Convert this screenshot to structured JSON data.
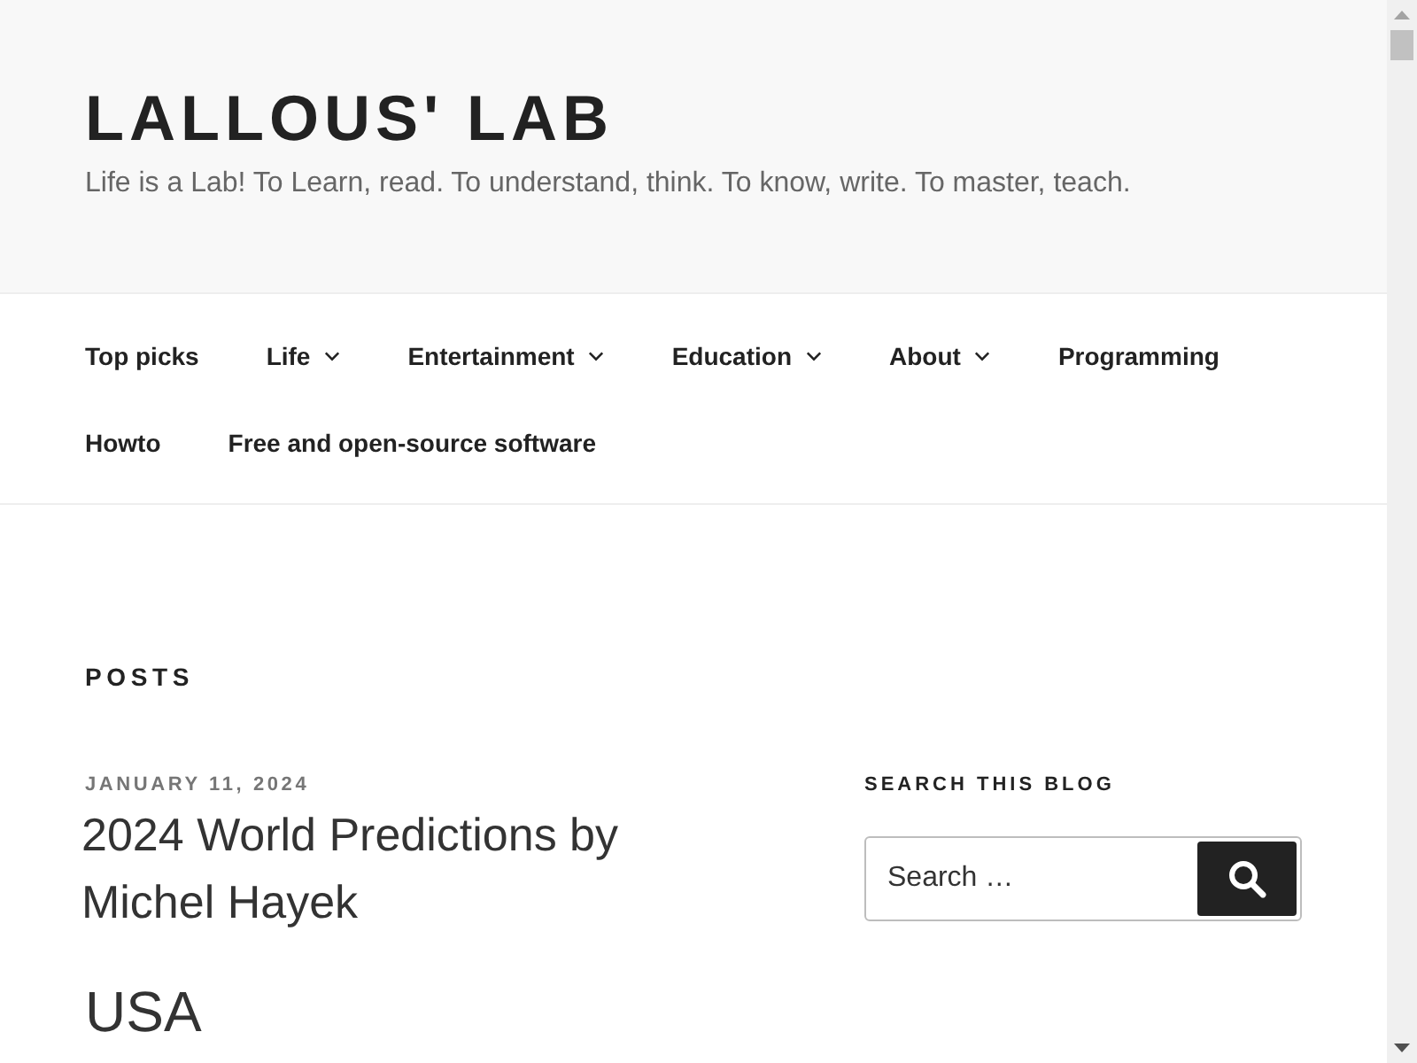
{
  "site": {
    "title": "LALLOUS' LAB",
    "tagline": "Life is a Lab! To Learn, read. To understand, think. To know, write. To master, teach."
  },
  "nav": {
    "items": [
      {
        "label": "Top picks",
        "submenu": false
      },
      {
        "label": "Life",
        "submenu": true
      },
      {
        "label": "Entertainment",
        "submenu": true
      },
      {
        "label": "Education",
        "submenu": true
      },
      {
        "label": "About",
        "submenu": true
      },
      {
        "label": "Programming",
        "submenu": false
      },
      {
        "label": "Howto",
        "submenu": false
      },
      {
        "label": "Free and open-source software",
        "submenu": false
      }
    ]
  },
  "page_heading": "POSTS",
  "post": {
    "date": "JANUARY 11, 2024",
    "title": "2024 World Predictions by Michel Hayek",
    "section_heading": "USA"
  },
  "sidebar": {
    "widget_title": "SEARCH THIS BLOG",
    "search": {
      "placeholder": "Search …"
    }
  }
}
